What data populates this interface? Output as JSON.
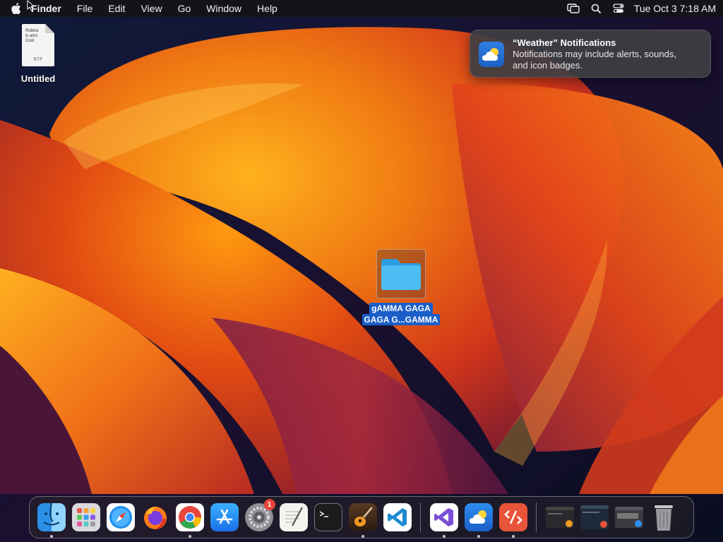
{
  "menubar": {
    "app_name": "Finder",
    "menus": [
      "File",
      "Edit",
      "View",
      "Go",
      "Window",
      "Help"
    ],
    "clock": "Tue Oct 3  7:18 AM",
    "icons": [
      "apple-icon",
      "screen-mirroring-icon",
      "spotlight-search-icon",
      "control-center-icon"
    ]
  },
  "desktop": {
    "file": {
      "name": "Untitled",
      "preview_lines": [
        "Roblox",
        "is also",
        "Cool"
      ],
      "extension": "RTF"
    },
    "folder": {
      "name_line1": "gAMMA GAGA",
      "name_line2": "GAGA G...GAMMA"
    }
  },
  "notification": {
    "title": "“Weather” Notifications",
    "body_line1": "Notifications may include alerts, sounds,",
    "body_line2": "and icon badges."
  },
  "dock": {
    "apps": [
      {
        "name": "Finder",
        "running": true
      },
      {
        "name": "Launchpad",
        "running": false
      },
      {
        "name": "Safari",
        "running": false
      },
      {
        "name": "Firefox",
        "running": false
      },
      {
        "name": "Google Chrome",
        "running": true
      },
      {
        "name": "App Store",
        "running": false
      },
      {
        "name": "System Settings",
        "running": false,
        "badge": "1"
      },
      {
        "name": "TextEdit",
        "running": false
      },
      {
        "name": "Terminal",
        "running": false
      },
      {
        "name": "GarageBand",
        "running": true
      },
      {
        "name": "Visual Studio Code",
        "running": false
      },
      {
        "name": "Visual Studio",
        "running": true
      },
      {
        "name": "Weather",
        "running": true
      },
      {
        "name": "Remote Desktop",
        "running": true
      },
      {
        "name": "Minimized Window 1",
        "running": false
      },
      {
        "name": "Minimized Window 2",
        "running": false
      },
      {
        "name": "Minimized Window 3",
        "running": false
      },
      {
        "name": "Trash",
        "running": false
      }
    ]
  },
  "colors": {
    "menubar_bg": "#141418",
    "selection_blue": "#1a5ec9",
    "badge_red": "#e8443a"
  }
}
